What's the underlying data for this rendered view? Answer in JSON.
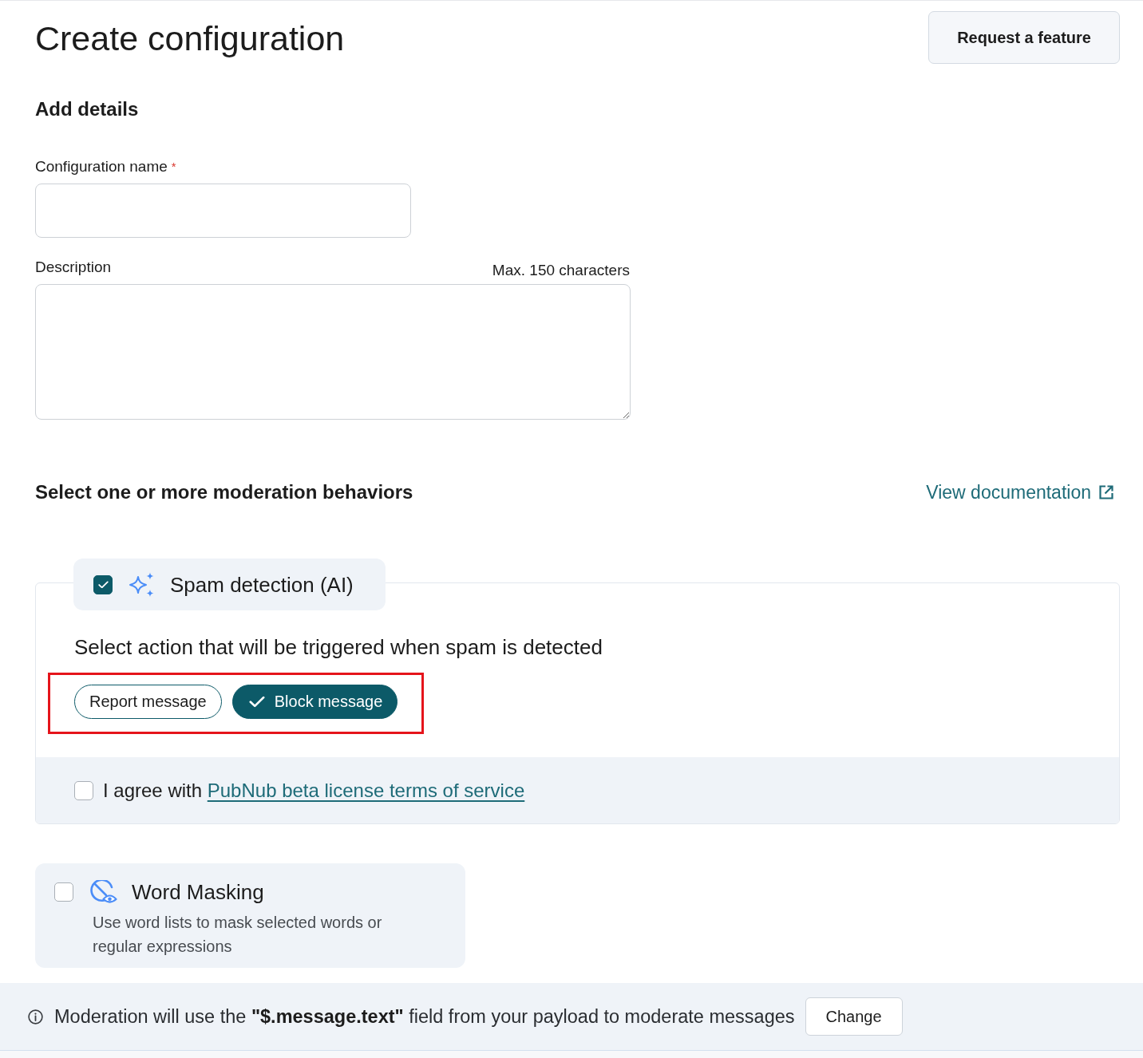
{
  "header": {
    "title": "Create configuration",
    "request_button": "Request a feature"
  },
  "details": {
    "heading": "Add details",
    "name_field": {
      "label": "Configuration name",
      "required_mark": "*"
    },
    "description_field": {
      "label": "Description",
      "hint": "Max. 150 characters"
    }
  },
  "behaviors": {
    "heading": "Select one or more moderation behaviors",
    "doc_link": "View documentation",
    "items": [
      {
        "kind": "panel",
        "checked": true,
        "title": "Spam detection (AI)",
        "prompt": "Select action that will be triggered when spam is detected",
        "actions_highlighted": true,
        "actions": [
          {
            "label": "Report message",
            "selected": false
          },
          {
            "label": "Block message",
            "selected": true
          }
        ],
        "agreement": {
          "checked": false,
          "text": "I agree with",
          "link": "PubNub beta license terms of service"
        }
      },
      {
        "kind": "card",
        "checked": false,
        "title": "Word Masking",
        "description": "Use word lists to mask selected words or regular expressions"
      }
    ]
  },
  "footer": {
    "text": "Moderation will use the **\"$.message.text\"** field from your payload to moderate messages",
    "button": "Change"
  }
}
